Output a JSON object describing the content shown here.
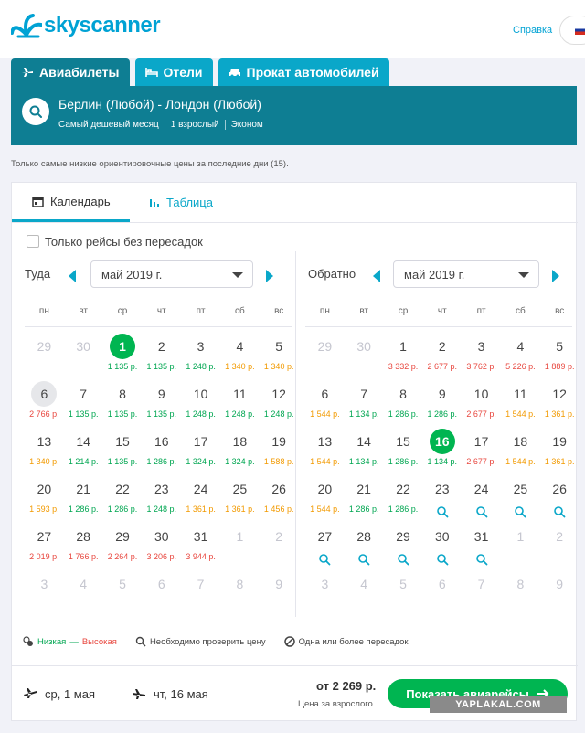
{
  "header": {
    "logo_text": "skyscanner",
    "help_link": "Справка",
    "brand_color": "#00a2d4"
  },
  "nav_tabs": [
    {
      "label": "Авиабилеты",
      "icon": "plane-icon",
      "active": true
    },
    {
      "label": "Отели",
      "icon": "bed-icon",
      "active": false
    },
    {
      "label": "Прокат автомобилей",
      "icon": "car-icon",
      "active": false
    }
  ],
  "search": {
    "route": "Берлин (Любой) - Лондон (Любой)",
    "meta": [
      "Самый дешевый месяц",
      "1 взрослый",
      "Эконом"
    ]
  },
  "notice": "Только самые низкие ориентировочные цены за последние дни (15).",
  "view_tabs": {
    "calendar": "Календарь",
    "table": "Таблица"
  },
  "direct_only_label": "Только рейсы без пересадок",
  "weekdays": [
    "пн",
    "вт",
    "ср",
    "чт",
    "пт",
    "сб",
    "вс"
  ],
  "outbound": {
    "label": "Туда",
    "month": "май 2019 г.",
    "weeks": [
      [
        {
          "d": "29",
          "dim": true
        },
        {
          "d": "30",
          "dim": true
        },
        {
          "d": "1",
          "p": "1 135 р.",
          "c": "g",
          "sel": true
        },
        {
          "d": "2",
          "p": "1 135 р.",
          "c": "g"
        },
        {
          "d": "3",
          "p": "1 248 р.",
          "c": "g"
        },
        {
          "d": "4",
          "p": "1 340 р.",
          "c": "o"
        },
        {
          "d": "5",
          "p": "1 340 р.",
          "c": "o"
        }
      ],
      [
        {
          "d": "6",
          "p": "2 766 р.",
          "c": "r",
          "hov": true
        },
        {
          "d": "7",
          "p": "1 135 р.",
          "c": "g"
        },
        {
          "d": "8",
          "p": "1 135 р.",
          "c": "g"
        },
        {
          "d": "9",
          "p": "1 135 р.",
          "c": "g"
        },
        {
          "d": "10",
          "p": "1 248 р.",
          "c": "g"
        },
        {
          "d": "11",
          "p": "1 248 р.",
          "c": "g"
        },
        {
          "d": "12",
          "p": "1 248 р.",
          "c": "g"
        }
      ],
      [
        {
          "d": "13",
          "p": "1 340 р.",
          "c": "o"
        },
        {
          "d": "14",
          "p": "1 214 р.",
          "c": "g"
        },
        {
          "d": "15",
          "p": "1 135 р.",
          "c": "g"
        },
        {
          "d": "16",
          "p": "1 286 р.",
          "c": "g"
        },
        {
          "d": "17",
          "p": "1 324 р.",
          "c": "g"
        },
        {
          "d": "18",
          "p": "1 324 р.",
          "c": "g"
        },
        {
          "d": "19",
          "p": "1 588 р.",
          "c": "o"
        }
      ],
      [
        {
          "d": "20",
          "p": "1 593 р.",
          "c": "o"
        },
        {
          "d": "21",
          "p": "1 286 р.",
          "c": "g"
        },
        {
          "d": "22",
          "p": "1 286 р.",
          "c": "g"
        },
        {
          "d": "23",
          "p": "1 248 р.",
          "c": "g"
        },
        {
          "d": "24",
          "p": "1 361 р.",
          "c": "o"
        },
        {
          "d": "25",
          "p": "1 361 р.",
          "c": "o"
        },
        {
          "d": "26",
          "p": "1 456 р.",
          "c": "o"
        }
      ],
      [
        {
          "d": "27",
          "p": "2 019 р.",
          "c": "r"
        },
        {
          "d": "28",
          "p": "1 766 р.",
          "c": "r"
        },
        {
          "d": "29",
          "p": "2 264 р.",
          "c": "r"
        },
        {
          "d": "30",
          "p": "3 206 р.",
          "c": "r"
        },
        {
          "d": "31",
          "p": "3 944 р.",
          "c": "r"
        },
        {
          "d": "1",
          "dim": true
        },
        {
          "d": "2",
          "dim": true
        }
      ],
      [
        {
          "d": "3",
          "dim": true
        },
        {
          "d": "4",
          "dim": true
        },
        {
          "d": "5",
          "dim": true
        },
        {
          "d": "6",
          "dim": true
        },
        {
          "d": "7",
          "dim": true
        },
        {
          "d": "8",
          "dim": true
        },
        {
          "d": "9",
          "dim": true
        }
      ]
    ]
  },
  "return": {
    "label": "Обратно",
    "month": "май 2019 г.",
    "weeks": [
      [
        {
          "d": "29",
          "dim": true
        },
        {
          "d": "30",
          "dim": true
        },
        {
          "d": "1",
          "p": "3 332 р.",
          "c": "r"
        },
        {
          "d": "2",
          "p": "2 677 р.",
          "c": "r"
        },
        {
          "d": "3",
          "p": "3 762 р.",
          "c": "r"
        },
        {
          "d": "4",
          "p": "5 226 р.",
          "c": "r"
        },
        {
          "d": "5",
          "p": "1 889 р.",
          "c": "r"
        }
      ],
      [
        {
          "d": "6",
          "p": "1 544 р.",
          "c": "o"
        },
        {
          "d": "7",
          "p": "1 134 р.",
          "c": "g"
        },
        {
          "d": "8",
          "p": "1 286 р.",
          "c": "g"
        },
        {
          "d": "9",
          "p": "1 286 р.",
          "c": "g"
        },
        {
          "d": "10",
          "p": "2 677 р.",
          "c": "r"
        },
        {
          "d": "11",
          "p": "1 544 р.",
          "c": "o"
        },
        {
          "d": "12",
          "p": "1 361 р.",
          "c": "o"
        }
      ],
      [
        {
          "d": "13",
          "p": "1 544 р.",
          "c": "o"
        },
        {
          "d": "14",
          "p": "1 134 р.",
          "c": "g"
        },
        {
          "d": "15",
          "p": "1 286 р.",
          "c": "g"
        },
        {
          "d": "16",
          "p": "1 134 р.",
          "c": "g",
          "sel": true
        },
        {
          "d": "17",
          "p": "2 677 р.",
          "c": "r"
        },
        {
          "d": "18",
          "p": "1 544 р.",
          "c": "o"
        },
        {
          "d": "19",
          "p": "1 361 р.",
          "c": "o"
        }
      ],
      [
        {
          "d": "20",
          "p": "1 544 р.",
          "c": "o"
        },
        {
          "d": "21",
          "p": "1 286 р.",
          "c": "g"
        },
        {
          "d": "22",
          "p": "1 286 р.",
          "c": "g"
        },
        {
          "d": "23",
          "check": true
        },
        {
          "d": "24",
          "check": true
        },
        {
          "d": "25",
          "check": true
        },
        {
          "d": "26",
          "check": true
        }
      ],
      [
        {
          "d": "27",
          "check": true
        },
        {
          "d": "28",
          "check": true
        },
        {
          "d": "29",
          "check": true
        },
        {
          "d": "30",
          "check": true
        },
        {
          "d": "31",
          "check": true
        },
        {
          "d": "1",
          "dim": true
        },
        {
          "d": "2",
          "dim": true
        }
      ],
      [
        {
          "d": "3",
          "dim": true
        },
        {
          "d": "4",
          "dim": true
        },
        {
          "d": "5",
          "dim": true
        },
        {
          "d": "6",
          "dim": true
        },
        {
          "d": "7",
          "dim": true
        },
        {
          "d": "8",
          "dim": true
        },
        {
          "d": "9",
          "dim": true
        }
      ]
    ]
  },
  "legend": {
    "low": "Низкая",
    "dash": "—",
    "high": "Высокая",
    "check_price": "Необходимо проверить цену",
    "stops": "Одна или более пересадок"
  },
  "footer": {
    "depart": "ср, 1 мая",
    "return": "чт, 16 мая",
    "price": "от 2 269 р.",
    "price_sub": "Цена за взрослого",
    "cta": "Показать авиарейсы"
  },
  "watermark": "YAPLAKAL.COM",
  "colors": {
    "low": "#00a651",
    "mid": "#f29a00",
    "high": "#e8473f",
    "selected": "#00b551",
    "accent": "#0aa7c9",
    "dark_accent": "#0e7e93"
  }
}
